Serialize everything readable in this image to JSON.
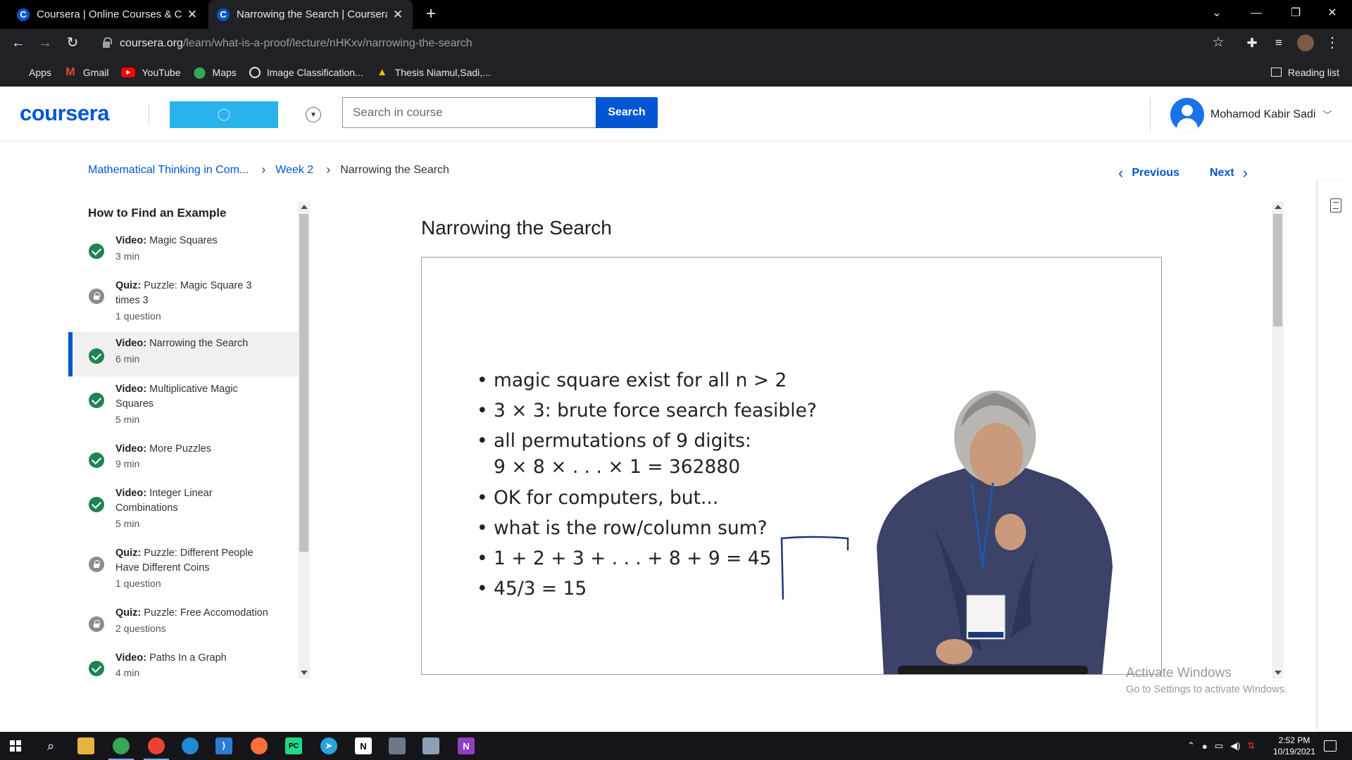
{
  "browser": {
    "tabs": [
      {
        "title": "Coursera | Online Courses & Crec",
        "favicon": "C"
      },
      {
        "title": "Narrowing the Search | Coursera",
        "favicon": "C"
      }
    ],
    "url_host": "coursera.org",
    "url_path": "/learn/what-is-a-proof/lecture/nHKxv/narrowing-the-search",
    "bookmarks": [
      {
        "label": "Apps",
        "icon": "apps-grid-icon"
      },
      {
        "label": "Gmail",
        "icon": "gmail-icon"
      },
      {
        "label": "YouTube",
        "icon": "youtube-icon"
      },
      {
        "label": "Maps",
        "icon": "maps-icon"
      },
      {
        "label": "Image Classification...",
        "icon": "globe-icon"
      },
      {
        "label": "Thesis Niamul,Sadi,...",
        "icon": "drive-icon"
      }
    ],
    "reading_list": "Reading list"
  },
  "header": {
    "logo": "coursera",
    "search_placeholder": "Search in course",
    "search_button": "Search",
    "user_name": "Mohamod Kabir Sadi"
  },
  "breadcrumb": {
    "course": "Mathematical Thinking in Com...",
    "week": "Week 2",
    "current": "Narrowing the Search"
  },
  "nav": {
    "previous": "Previous",
    "next": "Next"
  },
  "sidebar": {
    "title": "How to Find an Example",
    "items": [
      {
        "type": "Video:",
        "title": "Magic Squares",
        "meta": "3 min",
        "status": "completed"
      },
      {
        "type": "Quiz:",
        "title": "Puzzle: Magic Square 3 times 3",
        "meta": "1 question",
        "status": "locked"
      },
      {
        "type": "Video:",
        "title": "Narrowing the Search",
        "meta": "6 min",
        "status": "completed"
      },
      {
        "type": "Video:",
        "title": "Multiplicative Magic Squares",
        "meta": "5 min",
        "status": "completed"
      },
      {
        "type": "Video:",
        "title": "More Puzzles",
        "meta": "9 min",
        "status": "completed"
      },
      {
        "type": "Video:",
        "title": "Integer Linear Combinations",
        "meta": "5 min",
        "status": "completed"
      },
      {
        "type": "Quiz:",
        "title": "Puzzle: Different People Have Different Coins",
        "meta": "1 question",
        "status": "locked"
      },
      {
        "type": "Quiz:",
        "title": "Puzzle: Free Accomodation",
        "meta": "2 questions",
        "status": "locked"
      },
      {
        "type": "Video:",
        "title": "Paths In a Graph",
        "meta": "4 min",
        "status": "completed"
      }
    ]
  },
  "lecture": {
    "title": "Narrowing the Search",
    "slide_bullets": [
      "magic square exist for all n > 2",
      "3 × 3: brute force search feasible?",
      "all permutations of 9 digits:",
      "9 × 8 × . . . × 1 = 362880",
      "OK for computers, but...",
      "what is the row/column sum?",
      "1 + 2 + 3 + . . . + 8 + 9 = 45",
      "45/3 = 15"
    ]
  },
  "watermark": {
    "line1": "Activate Windows",
    "line2": "Go to Settings to activate Windows."
  },
  "taskbar": {
    "time": "2:52 PM",
    "date": "10/19/2021"
  }
}
